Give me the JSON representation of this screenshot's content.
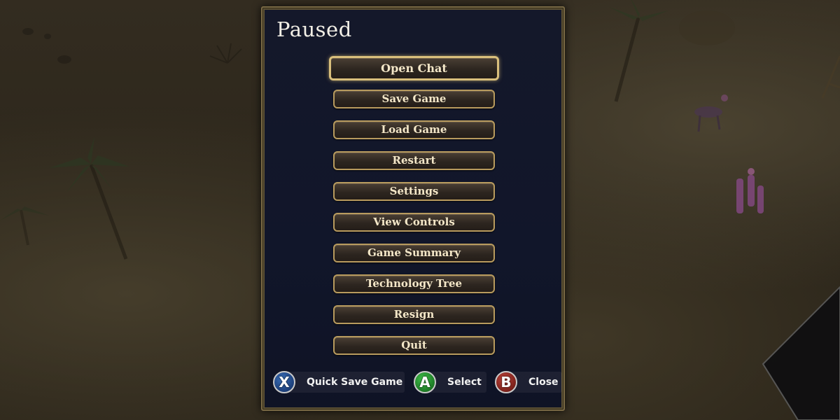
{
  "panel": {
    "title": "Paused"
  },
  "menu": {
    "items": [
      {
        "label": "Open Chat",
        "focused": true
      },
      {
        "label": "Save Game"
      },
      {
        "label": "Load Game"
      },
      {
        "label": "Restart"
      },
      {
        "label": "Settings"
      },
      {
        "label": "View Controls"
      },
      {
        "label": "Game Summary"
      },
      {
        "label": "Technology Tree"
      },
      {
        "label": "Resign"
      },
      {
        "label": "Quit"
      }
    ]
  },
  "hints": {
    "quick_save": {
      "glyph": "X",
      "label": "Quick Save Game",
      "icon": "x-button-icon",
      "color": "#2a5597"
    },
    "select": {
      "glyph": "A",
      "label": "Select",
      "icon": "a-button-icon",
      "color": "#2b9a35"
    },
    "close": {
      "glyph": "B",
      "label": "Close",
      "icon": "b-button-icon",
      "color": "#9b2e27"
    }
  },
  "colors": {
    "panel_bg": "#12172a",
    "panel_border": "#7a6a45",
    "button_border": "#b89b5e",
    "button_text": "#f4e7c8"
  }
}
